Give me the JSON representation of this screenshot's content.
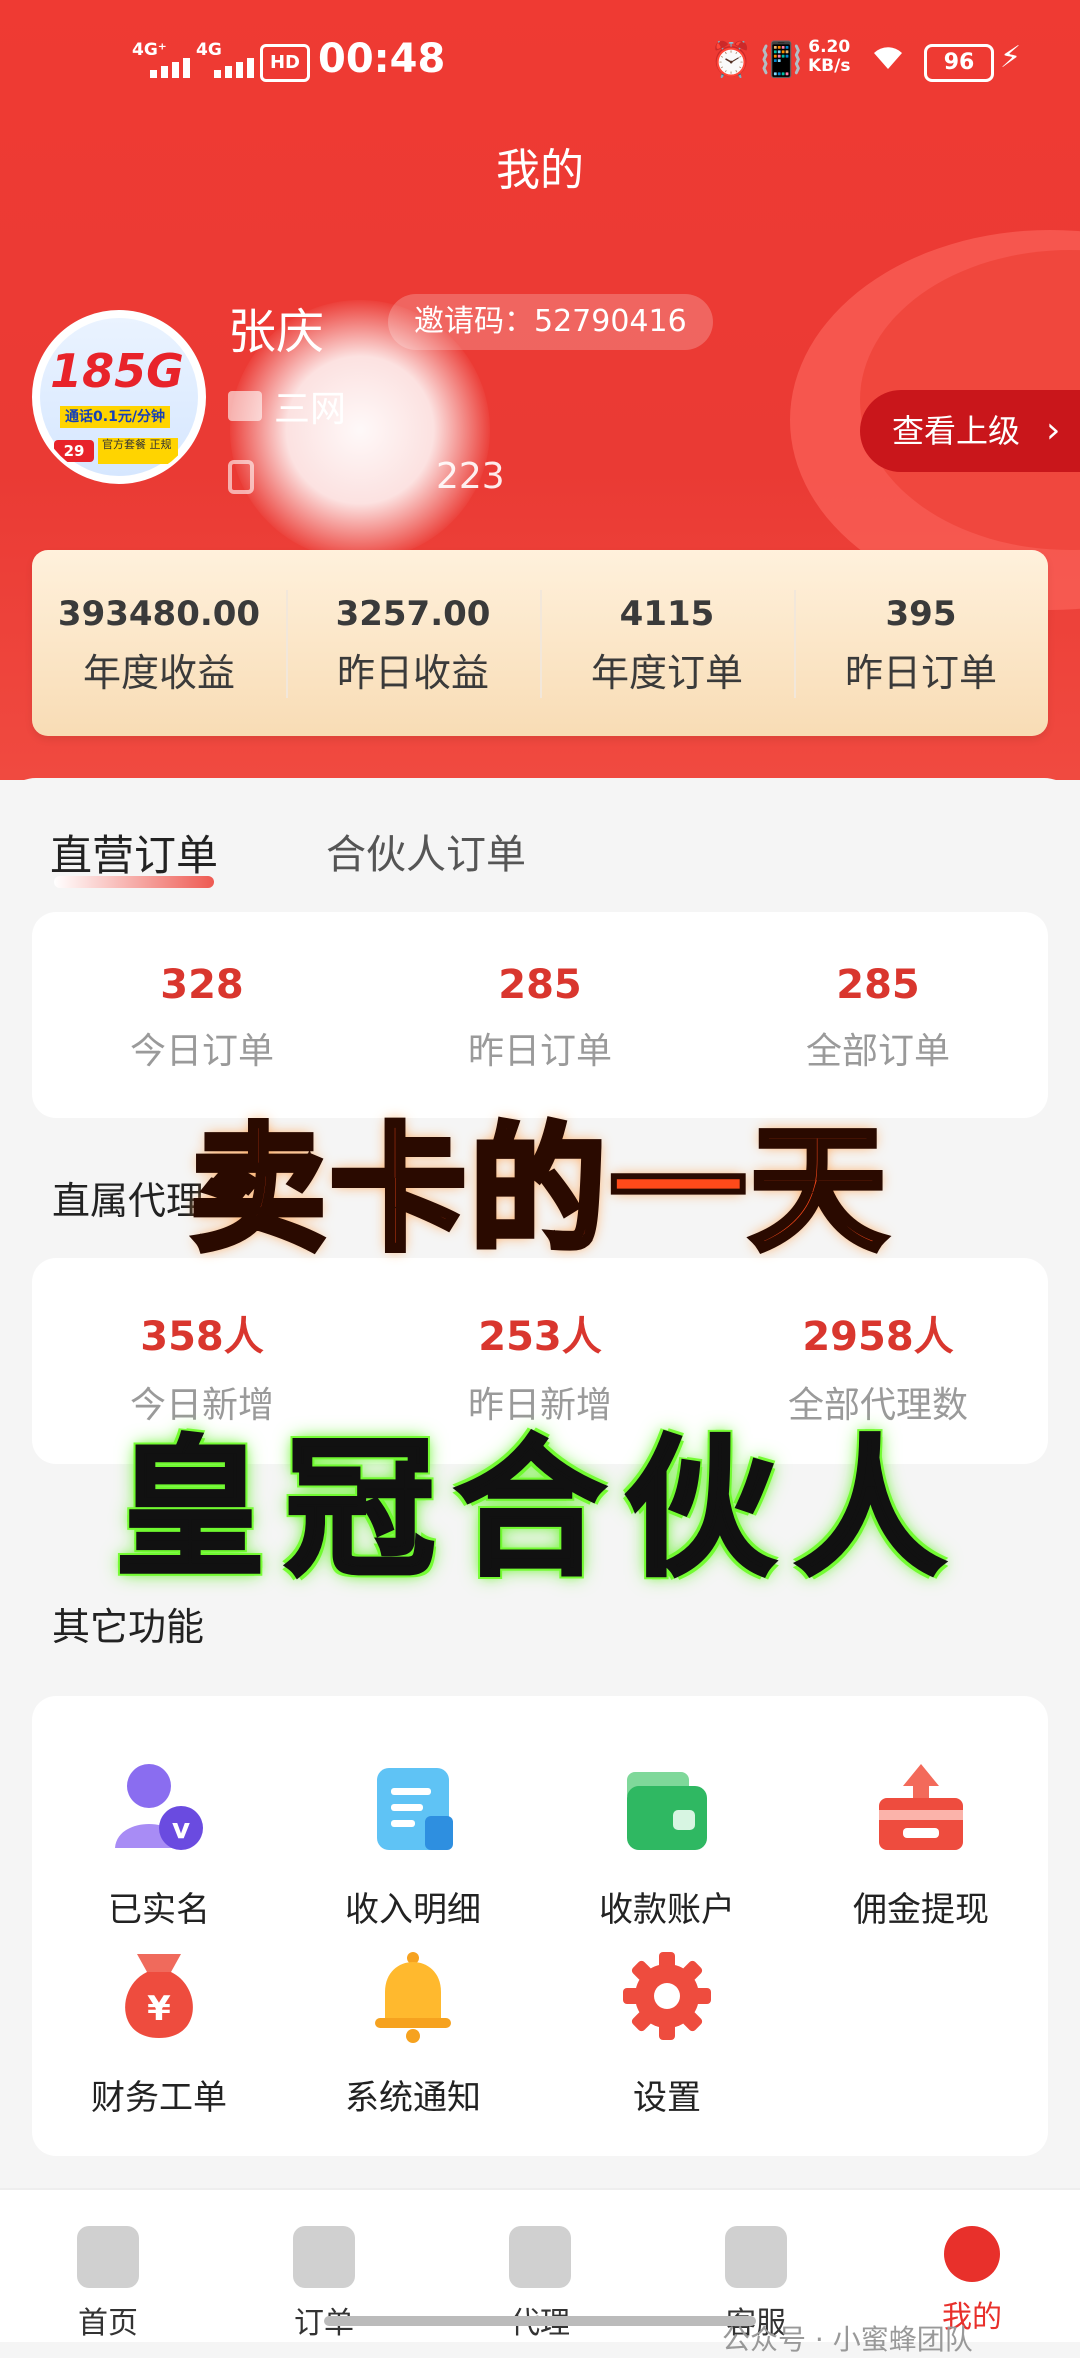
{
  "status_bar": {
    "sig1": "4G⁺",
    "sig2": "4G",
    "hd": "HD",
    "time": "00:48",
    "speed": "6.20\nKB/s",
    "battery": "96"
  },
  "header": {
    "title": "我的"
  },
  "profile": {
    "avatar_big": "185G",
    "avatar_small": "通话0.1元/分钟",
    "avatar_tag": "29",
    "avatar_tag2": "官方套餐 正规",
    "name": "张庆",
    "invite_label": "邀请码：",
    "invite_code": "52790416",
    "line2": "三网",
    "line3": "223",
    "superior_button": "查看上级"
  },
  "summary": [
    {
      "value": "393480.00",
      "label": "年度收益"
    },
    {
      "value": "3257.00",
      "label": "昨日收益"
    },
    {
      "value": "4115",
      "label": "年度订单"
    },
    {
      "value": "395",
      "label": "昨日订单"
    }
  ],
  "tabs": [
    {
      "label": "直营订单"
    },
    {
      "label": "合伙人订单"
    }
  ],
  "orders": [
    {
      "value": "328",
      "label": "今日订单"
    },
    {
      "value": "285",
      "label": "昨日订单"
    },
    {
      "value": "285",
      "label": "全部订单"
    }
  ],
  "agents_title": "直属代理",
  "agents": [
    {
      "value": "358人",
      "label": "今日新增"
    },
    {
      "value": "253人",
      "label": "昨日新增"
    },
    {
      "value": "2958人",
      "label": "全部代理数"
    }
  ],
  "overlay": {
    "line1": "卖卡的一天",
    "line2": "皇冠合伙人"
  },
  "functions_title": "其它功能",
  "functions": [
    {
      "label": "已实名",
      "icon": "verified-user-icon"
    },
    {
      "label": "收入明细",
      "icon": "document-list-icon"
    },
    {
      "label": "收款账户",
      "icon": "wallet-icon"
    },
    {
      "label": "佣金提现",
      "icon": "withdraw-box-icon"
    },
    {
      "label": "财务工单",
      "icon": "money-bag-icon"
    },
    {
      "label": "系统通知",
      "icon": "bell-icon"
    },
    {
      "label": "设置",
      "icon": "gear-icon"
    }
  ],
  "tabbar": [
    {
      "label": "首页",
      "icon": "home-icon"
    },
    {
      "label": "订单",
      "icon": "order-icon"
    },
    {
      "label": "代理",
      "icon": "agent-icon"
    },
    {
      "label": "客服",
      "icon": "chat-icon"
    },
    {
      "label": "我的",
      "icon": "profile-icon"
    }
  ],
  "watermark": "公众号 · 小蜜蜂团队",
  "colors": {
    "brand_red": "#e8302b",
    "value_red": "#d9362e",
    "gold_card": "#f8dcb5"
  }
}
